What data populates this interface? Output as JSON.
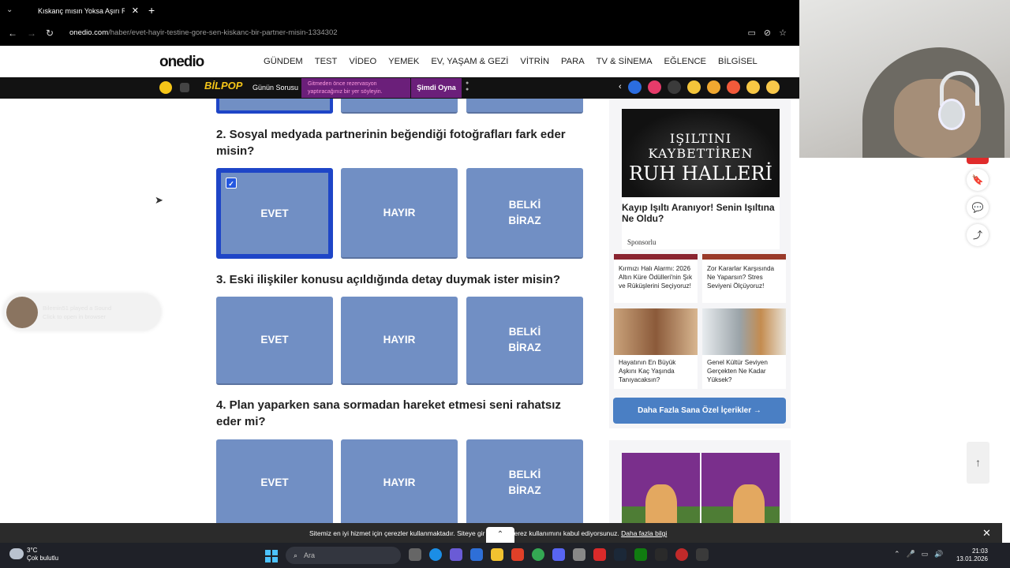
{
  "browser": {
    "tab_title": "Kıskanç mısın Yoksa Aşırı Rahat",
    "url_host": "onedio.com",
    "url_path": "/haber/evet-hayir-testine-gore-sen-kiskanc-bir-partner-misin-1334302"
  },
  "site": {
    "logo": "onedio",
    "nav": [
      "GÜNDEM",
      "TEST",
      "VİDEO",
      "YEMEK",
      "EV, YAŞAM & GEZİ",
      "VİTRİN",
      "PARA",
      "TV & SİNEMA",
      "EĞLENCE",
      "BİLGİSEL"
    ]
  },
  "strip": {
    "bilpop": "BİLPOP",
    "gunun_sorusu": "Günün Sorusu",
    "ad_text": "Gitmeden önce rezervasyon yaptıracağınız bir yer söyleyin.",
    "play": "Şimdi Oyna"
  },
  "quiz": {
    "questions": [
      {
        "title": "2. Sosyal medyada partnerinin beğendiği fotoğrafları fark eder misin?",
        "options": [
          "EVET",
          "HAYIR",
          "BELKİ BİRAZ"
        ],
        "selected": 0
      },
      {
        "title": "3. Eski ilişkiler konusu açıldığında detay duymak ister misin?",
        "options": [
          "EVET",
          "HAYIR",
          "BELKİ BİRAZ"
        ],
        "selected": -1
      },
      {
        "title": "4. Plan yaparken sana sormadan hareket etmesi seni rahatsız eder mi?",
        "options": [
          "EVET",
          "HAYIR",
          "BELKİ BİRAZ"
        ],
        "selected": -1
      }
    ]
  },
  "sidebar": {
    "ad": {
      "image_line1": "IŞILTINI KAYBETTİREN",
      "image_line2": "RUH HALLERİ",
      "title": "Kayıp Işıltı Aranıyor! Senin Işıltına Ne Oldu?",
      "sponsor": "Sponsorlu"
    },
    "cards": [
      {
        "caption": "Kırmızı Halı Alarmı: 2026 Altın Küre Ödülleri'nin Şık ve Rüküşlerini Seçiyoruz!"
      },
      {
        "caption": "Zor Kararlar Karşısında Ne Yaparsın? Stres Seviyeni Ölçüyoruz!"
      },
      {
        "caption": "Hayatının En Büyük Aşkını Kaç Yaşında Tanıyacaksın?"
      },
      {
        "caption": "Genel Kültür Seviyen Gerçekten Ne Kadar Yüksek?"
      }
    ],
    "more_button": "Daha Fazla Sana Özel İçerikler  →"
  },
  "toast": {
    "line1": "Bilemin51 played a Sound",
    "line2": "Click to open in browser"
  },
  "cookie": {
    "message_start": "Sitemiz en iyi hizmet için çerezler kullanmaktadır. Siteye gir",
    "message_end": "çerez kullanımını kabul ediyorsunuz.",
    "link": "Daha fazla bilgi"
  },
  "taskbar": {
    "temp": "3°C",
    "weather": "Çok bulutlu",
    "search_placeholder": "Ara",
    "time": "21:03",
    "date": "13.01.2026"
  }
}
